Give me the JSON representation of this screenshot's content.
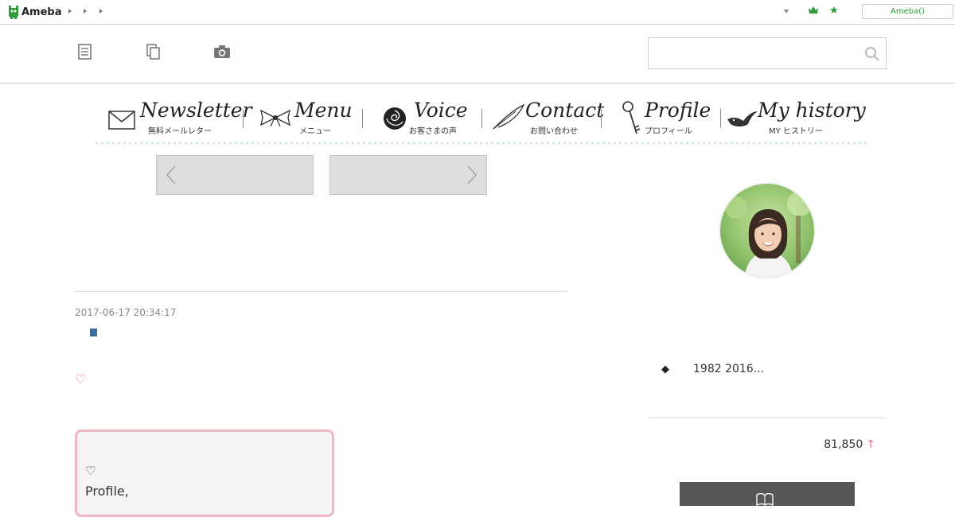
{
  "topbar": {
    "logo_text": "Ameba",
    "ameba_button": "Ameba()"
  },
  "nav": {
    "items": [
      {
        "title": "Newsletter",
        "sub": "無料メールレター",
        "icon": "envelope-icon"
      },
      {
        "title": "Menu",
        "sub": "メニュー",
        "icon": "ribbon-icon"
      },
      {
        "title": "Voice",
        "sub": "お客さまの声",
        "icon": "rose-icon"
      },
      {
        "title": "Contact",
        "sub": "お問い合わせ",
        "icon": "feather-icon"
      },
      {
        "title": "Profile",
        "sub": "プロフィール",
        "icon": "key-icon"
      },
      {
        "title": "My history",
        "sub": "MY ヒストリー",
        "icon": "bird-icon"
      }
    ]
  },
  "entry": {
    "date": "2017-06-17 20:34:17",
    "heart": "♡",
    "profile_box": {
      "heart": "♡",
      "text": "Profile,"
    }
  },
  "sidebar": {
    "bullet": "◆",
    "intro": "1982 2016...",
    "count": "81,850",
    "count_arrow": "↑"
  },
  "colors": {
    "brand_green": "#2f9a3a",
    "accent_pink": "#e46aa0",
    "box_border": "#f0b7c3",
    "bullet_blue": "#3a6ea8"
  }
}
